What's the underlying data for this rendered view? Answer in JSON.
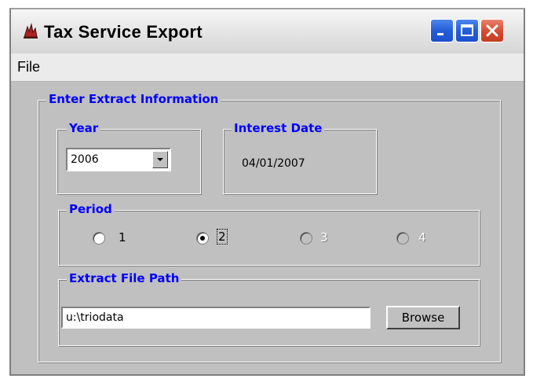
{
  "window": {
    "title": "Tax Service Export",
    "icon": "app-icon",
    "controls": [
      "minimize-icon",
      "maximize-icon",
      "close-icon"
    ]
  },
  "menu": {
    "file_label": "File"
  },
  "extract": {
    "group_label": "Enter Extract Information",
    "year": {
      "label": "Year",
      "value": "2006"
    },
    "interest_date": {
      "label": "Interest Date",
      "value": "04/01/2007"
    },
    "period": {
      "label": "Period",
      "options": [
        {
          "label": "1",
          "selected": false,
          "enabled": true
        },
        {
          "label": "2",
          "selected": true,
          "enabled": true
        },
        {
          "label": "3",
          "selected": false,
          "enabled": false
        },
        {
          "label": "4",
          "selected": false,
          "enabled": false
        }
      ]
    },
    "file_path": {
      "label": "Extract File Path",
      "value": "u:\\triodata",
      "browse_label": "Browse"
    }
  },
  "colors": {
    "legend": "#0000ff",
    "face": "#c0c0c0",
    "close_button": "#d34a2f",
    "title_buttons": "#245ed8"
  }
}
